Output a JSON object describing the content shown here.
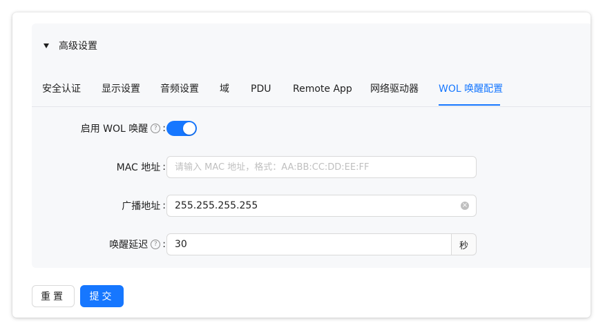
{
  "collapse": {
    "title": "高级设置",
    "expanded": true
  },
  "tabs": [
    {
      "label": "安全认证"
    },
    {
      "label": "显示设置"
    },
    {
      "label": "音频设置"
    },
    {
      "label": "域"
    },
    {
      "label": "PDU"
    },
    {
      "label": "Remote App"
    },
    {
      "label": "网络驱动器"
    },
    {
      "label": "WOL 唤醒配置"
    }
  ],
  "active_tab": "WOL 唤醒配置",
  "form": {
    "wol_enable": {
      "label": "启用 WOL 唤醒",
      "colon": ":",
      "help_icon": "question-circle-icon",
      "value": true
    },
    "mac": {
      "label": "MAC 地址",
      "colon": ":",
      "value": "",
      "placeholder": "请输入 MAC 地址，格式：AA:BB:CC:DD:EE:FF"
    },
    "broadcast": {
      "label": "广播地址",
      "colon": ":",
      "value": "255.255.255.255",
      "clear_icon": "close-circle-icon"
    },
    "delay": {
      "label": "唤醒延迟",
      "colon": ":",
      "help_icon": "question-circle-icon",
      "value": "30",
      "unit": "秒"
    }
  },
  "buttons": {
    "reset_label": "重置",
    "submit_label": "提交"
  },
  "colors": {
    "primary": "#1677ff",
    "panel_bg": "#f7f8fa",
    "border": "#d9d9d9"
  }
}
